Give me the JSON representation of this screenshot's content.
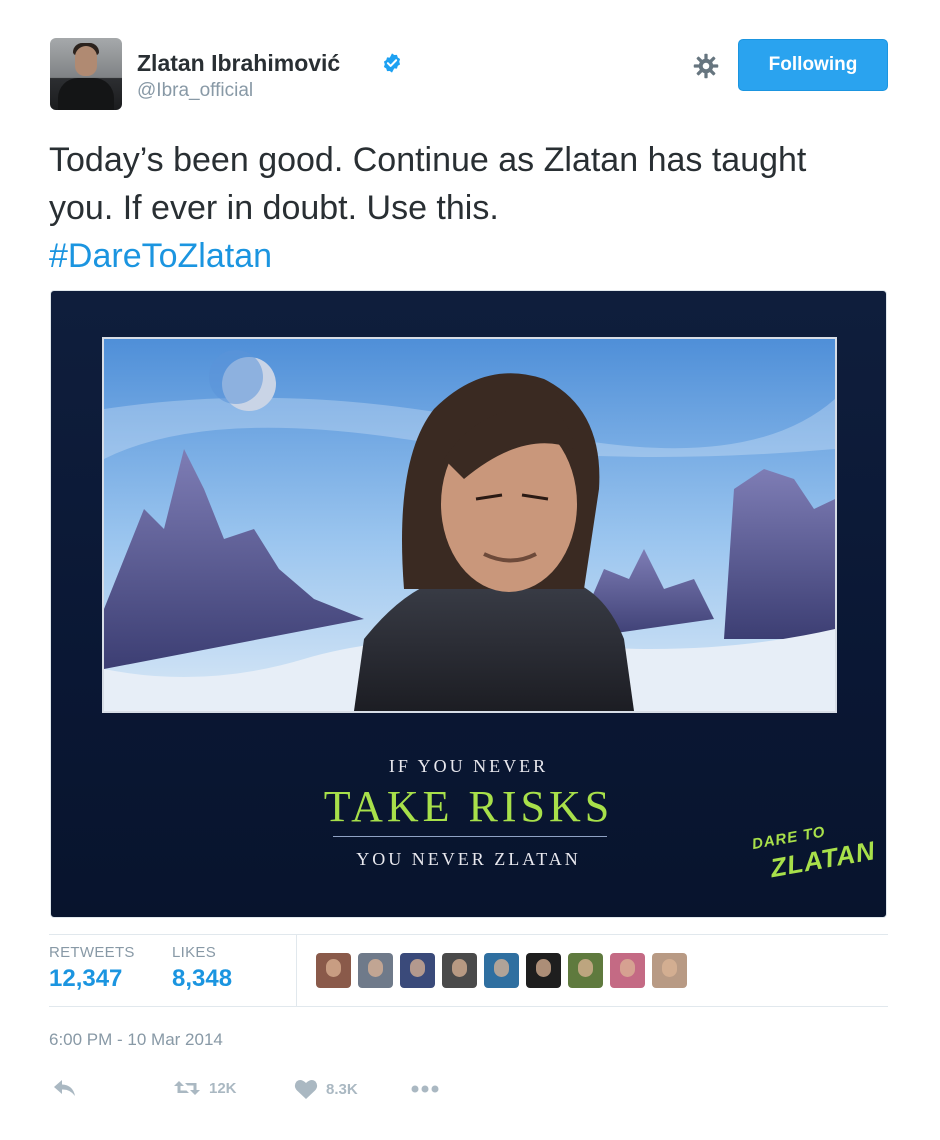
{
  "author": {
    "name": "Zlatan Ibrahimović",
    "handle": "@Ibra_official",
    "follow_label": "Following"
  },
  "tweet": {
    "text": "Today’s been good. Continue as Zlatan has taught you. If ever in doubt. Use this.",
    "hashtag": "#DareToZlatan"
  },
  "media": {
    "line_top": "IF YOU NEVER",
    "line_main": "TAKE RISKS",
    "line_bottom": "YOU NEVER ZLATAN",
    "logo_line1": "DARE TO",
    "logo_line2": "ZLATAN",
    "accent_color": "#a8e04a"
  },
  "stats": {
    "retweets_label": "RETWEETS",
    "retweets_value": "12,347",
    "likes_label": "LIKES",
    "likes_value": "8,348",
    "liker_avatar_colors": [
      "#8a5a4a",
      "#6f7a8a",
      "#3a4a7a",
      "#4a4a4a",
      "#2f6fa0",
      "#1e1e1e",
      "#5f7a3e",
      "#c46a84",
      "#b89a84"
    ]
  },
  "timestamp": "6:00 PM - 10 Mar 2014",
  "actions": {
    "reply_icon": "reply-icon",
    "retweet_count": "12K",
    "like_count": "8.3K",
    "more_icon": "more-icon"
  },
  "colors": {
    "link": "#1b95e0",
    "button": "#2aa3ef",
    "muted": "#8899a6"
  }
}
